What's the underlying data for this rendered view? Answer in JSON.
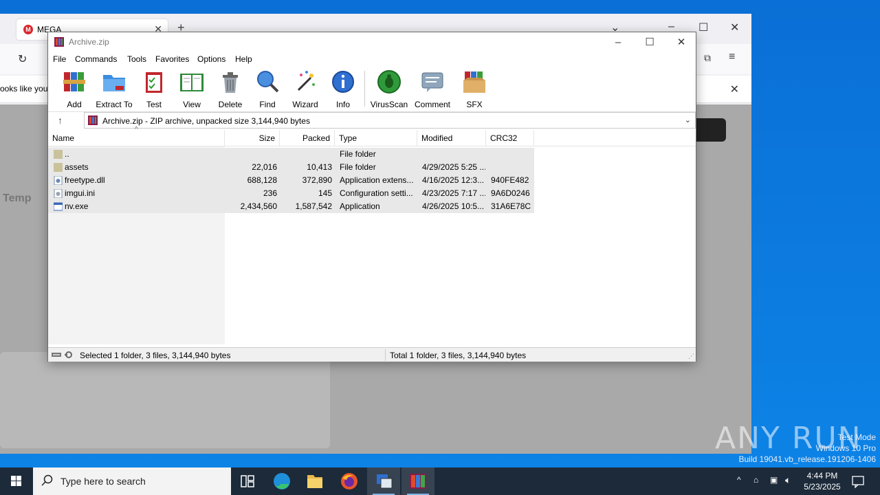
{
  "desktop": {
    "watermark_line1": "Test Mode",
    "watermark_line2": "Windows 10 Pro",
    "watermark_line3": "Build 19041.vb_release.191206-1406",
    "anyrun_text": "ANY RUN"
  },
  "browser": {
    "tab_label": "MEGA",
    "notice_text": "ooks like you",
    "content_text": "Temp"
  },
  "window": {
    "title": "Archive.zip",
    "menu": [
      "File",
      "Commands",
      "Tools",
      "Favorites",
      "Options",
      "Help"
    ],
    "toolbar": [
      {
        "label": "Add",
        "icon": "add-books-icon"
      },
      {
        "label": "Extract To",
        "icon": "extract-folder-icon"
      },
      {
        "label": "Test",
        "icon": "test-clipboard-icon"
      },
      {
        "label": "View",
        "icon": "view-book-icon"
      },
      {
        "label": "Delete",
        "icon": "trash-icon"
      },
      {
        "label": "Find",
        "icon": "magnifier-icon"
      },
      {
        "label": "Wizard",
        "icon": "wand-icon"
      },
      {
        "label": "Info",
        "icon": "info-icon"
      },
      {
        "label": "VirusScan",
        "icon": "bug-icon"
      },
      {
        "label": "Comment",
        "icon": "comment-icon"
      },
      {
        "label": "SFX",
        "icon": "sfx-box-icon"
      }
    ],
    "path": "Archive.zip - ZIP archive, unpacked size 3,144,940 bytes",
    "columns": [
      "Name",
      "Size",
      "Packed",
      "Type",
      "Modified",
      "CRC32"
    ],
    "rows": [
      {
        "name": "..",
        "size": "",
        "packed": "",
        "type": "File folder",
        "modified": "",
        "crc": "",
        "icon": "folder-up-icon"
      },
      {
        "name": "assets",
        "size": "22,016",
        "packed": "10,413",
        "type": "File folder",
        "modified": "4/29/2025 5:25 ...",
        "crc": "",
        "icon": "folder-icon"
      },
      {
        "name": "freetype.dll",
        "size": "688,128",
        "packed": "372,890",
        "type": "Application extens...",
        "modified": "4/16/2025 12:3...",
        "crc": "940FE482",
        "icon": "dll-file-icon"
      },
      {
        "name": "imgui.ini",
        "size": "236",
        "packed": "145",
        "type": "Configuration setti...",
        "modified": "4/23/2025 7:17 ...",
        "crc": "9A6D0246",
        "icon": "ini-file-icon"
      },
      {
        "name": "nv.exe",
        "size": "2,434,560",
        "packed": "1,587,542",
        "type": "Application",
        "modified": "4/26/2025 10:5...",
        "crc": "31A6E78C",
        "icon": "exe-file-icon"
      }
    ],
    "status_left": "Selected 1 folder, 3 files, 3,144,940 bytes",
    "status_right": "Total 1 folder, 3 files, 3,144,940 bytes"
  },
  "taskbar": {
    "search_placeholder": "Type here to search",
    "time": "4:44 PM",
    "date": "5/23/2025"
  },
  "colors": {
    "desktop_blue": "#0a6fd6",
    "taskbar": "#1c2a3a",
    "row_selected": "#e8e8e8"
  }
}
